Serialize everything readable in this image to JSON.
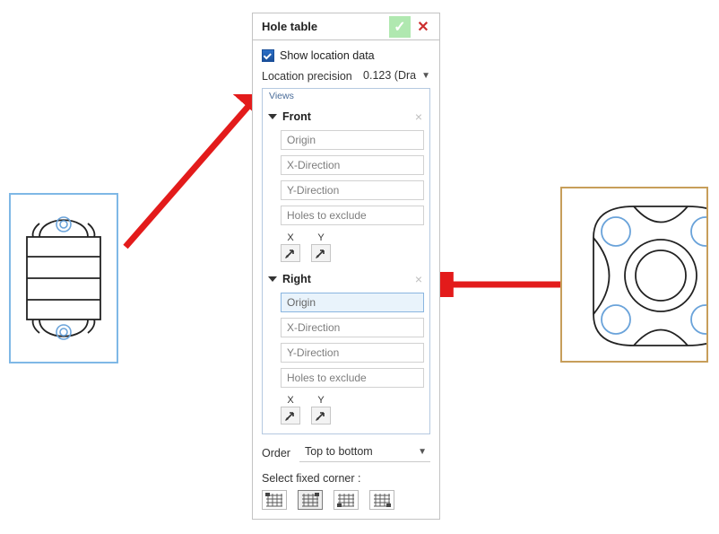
{
  "dialog": {
    "title": "Hole table",
    "show_location_data_label": "Show location data",
    "location_precision_label": "Location precision",
    "location_precision_value": "0.123 (Dra",
    "views_box_label": "Views",
    "views": [
      {
        "name": "Front",
        "fields": {
          "origin_placeholder": "Origin",
          "x_dir_placeholder": "X-Direction",
          "y_dir_placeholder": "Y-Direction",
          "holes_exclude_placeholder": "Holes to exclude",
          "origin_selected": false
        },
        "xy_labels": {
          "x": "X",
          "y": "Y"
        }
      },
      {
        "name": "Right",
        "fields": {
          "origin_placeholder": "Origin",
          "x_dir_placeholder": "X-Direction",
          "y_dir_placeholder": "Y-Direction",
          "holes_exclude_placeholder": "Holes to exclude",
          "origin_selected": true
        },
        "xy_labels": {
          "x": "X",
          "y": "Y"
        }
      }
    ],
    "order_label": "Order",
    "order_value": "Top to bottom",
    "select_fixed_corner_label": "Select fixed corner :"
  },
  "icons": {
    "confirm": "check-icon",
    "close": "close-icon",
    "chevron_down": "chevron-down-icon",
    "flip": "flip-arrow-icon",
    "corner": "corner-icon"
  },
  "colors": {
    "accent_blue": "#6aa3da",
    "selected_field_bg": "#e9f3fb",
    "front_view_border": "#7fb8e6",
    "right_view_border": "#c79e5a",
    "arrow_red": "#e31b1b"
  }
}
